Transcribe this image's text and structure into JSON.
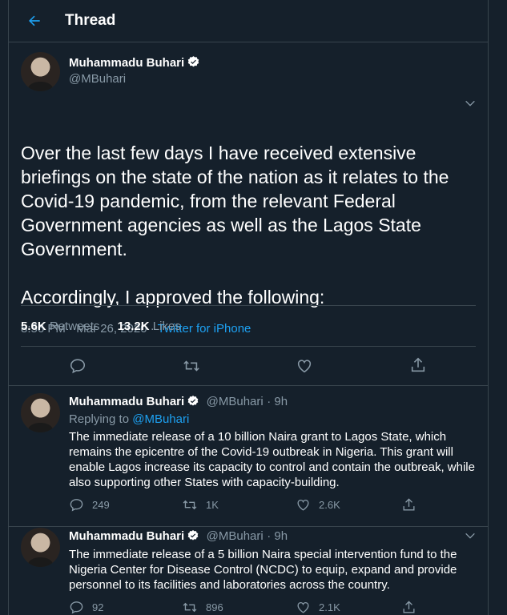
{
  "header": {
    "back_icon": "arrow-left-icon",
    "title": "Thread"
  },
  "main_tweet": {
    "name": "Muhammadu Buhari",
    "handle": "@MBuhari",
    "text": "Over the last few days I have received extensive briefings on the state of the nation as it relates to the Covid-19 pandemic, from the relevant Federal Government agencies as well as the Lagos State Government.\n\nAccordingly, I approved the following:",
    "time": "8:56 PM · Mar 26, 2020",
    "separator": " · ",
    "source": "Twitter for iPhone",
    "retweets_count": "5.6K",
    "retweets_label": "Retweets",
    "likes_count": "13.2K",
    "likes_label": "Likes"
  },
  "replies": [
    {
      "name": "Muhammadu Buhari",
      "handle": "@MBuhari",
      "time": "· 9h",
      "replying_prefix": "Replying to ",
      "replying_to": "@MBuhari",
      "text": "The immediate release of a 10 billion Naira grant to Lagos State, which remains the epicentre of the Covid-19 outbreak in Nigeria. This grant will enable Lagos increase its capacity to control and contain the outbreak, while also supporting other States with capacity-building.",
      "replies": "249",
      "retweets": "1K",
      "likes": "2.6K"
    },
    {
      "name": "Muhammadu Buhari",
      "handle": "@MBuhari",
      "time": "· 9h",
      "text": "The immediate release of a 5 billion Naira special intervention fund to the Nigeria Center for Disease Control (NCDC) to equip, expand and provide personnel to its facilities and laboratories across the country.",
      "replies": "92",
      "retweets": "896",
      "likes": "2.1K"
    }
  ],
  "colors": {
    "background": "#15202b",
    "accent": "#1da1f2",
    "muted": "#8899a6",
    "border": "#38444d"
  }
}
